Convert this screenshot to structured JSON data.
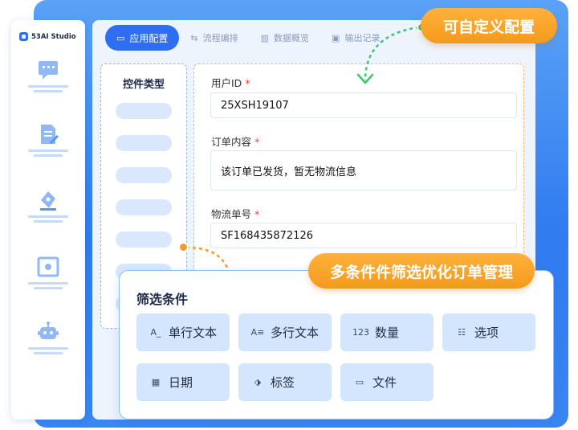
{
  "app": {
    "brand": "53AI Studio"
  },
  "sidebar": {
    "items": [
      {
        "icon": "chat-icon"
      },
      {
        "icon": "document-edit-icon"
      },
      {
        "icon": "pen-nib-icon"
      },
      {
        "icon": "image-frame-icon"
      },
      {
        "icon": "robot-icon"
      }
    ]
  },
  "tabs": [
    {
      "label": "应用配置",
      "icon": "app-config-icon",
      "active": true
    },
    {
      "label": "流程编排",
      "icon": "flow-icon",
      "active": false
    },
    {
      "label": "数据概览",
      "icon": "bar-chart-icon",
      "active": false
    },
    {
      "label": "输出记录",
      "icon": "record-icon",
      "active": false
    }
  ],
  "controls": {
    "title": "控件类型"
  },
  "form": {
    "fields": [
      {
        "label": "用户ID",
        "required_mark": "*",
        "value": "25XSH19107"
      },
      {
        "label": "订单内容",
        "required_mark": "*",
        "value": "该订单已发货，暂无物流信息"
      },
      {
        "label": "物流单号",
        "required_mark": "*",
        "value": "SF168435872126"
      }
    ]
  },
  "callouts": {
    "top": "可自定义配置",
    "bottom": "多条件件筛选优化订单管理"
  },
  "filter": {
    "title": "筛选条件",
    "chips": [
      {
        "label": "单行文本",
        "icon": "single-line-text-icon",
        "glyph": "A_"
      },
      {
        "label": "多行文本",
        "icon": "multi-line-text-icon",
        "glyph": "A≡"
      },
      {
        "label": "数量",
        "icon": "number-icon",
        "glyph": "123"
      },
      {
        "label": "选项",
        "icon": "options-icon",
        "glyph": "☷"
      },
      {
        "label": "日期",
        "icon": "calendar-icon",
        "glyph": "▦"
      },
      {
        "label": "标签",
        "icon": "tag-icon",
        "glyph": "⬗"
      },
      {
        "label": "文件",
        "icon": "folder-icon",
        "glyph": "▭"
      }
    ]
  },
  "colors": {
    "primary": "#2f6ef0",
    "accent_orange": "#f5a623",
    "chip_bg": "#d4e6fd"
  }
}
